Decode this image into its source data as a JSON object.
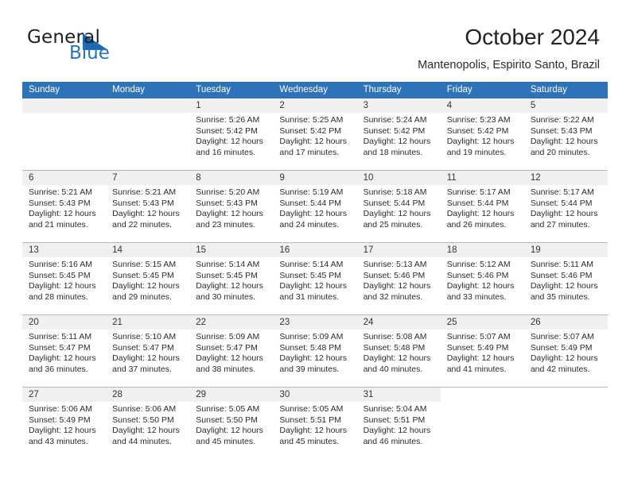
{
  "brand": {
    "name_top": "General",
    "name_bottom": "Blue",
    "accent_color": "#2a74b5",
    "triangle_color": "#1b69b0"
  },
  "header": {
    "month_title": "October 2024",
    "location": "Mantenopolis, Espirito Santo, Brazil"
  },
  "calendar": {
    "header_color": "#2e72b8",
    "date_strip_color": "#f0f0f0",
    "weekdays": [
      "Sunday",
      "Monday",
      "Tuesday",
      "Wednesday",
      "Thursday",
      "Friday",
      "Saturday"
    ],
    "labels": {
      "sunrise": "Sunrise:",
      "sunset": "Sunset:",
      "daylight": "Daylight:"
    },
    "weeks": [
      [
        {
          "type": "blank"
        },
        {
          "type": "blank"
        },
        {
          "type": "day",
          "date": "1",
          "sunrise": "Sunrise: 5:26 AM",
          "sunset": "Sunset: 5:42 PM",
          "daylight_1": "Daylight: 12 hours",
          "daylight_2": "and 16 minutes."
        },
        {
          "type": "day",
          "date": "2",
          "sunrise": "Sunrise: 5:25 AM",
          "sunset": "Sunset: 5:42 PM",
          "daylight_1": "Daylight: 12 hours",
          "daylight_2": "and 17 minutes."
        },
        {
          "type": "day",
          "date": "3",
          "sunrise": "Sunrise: 5:24 AM",
          "sunset": "Sunset: 5:42 PM",
          "daylight_1": "Daylight: 12 hours",
          "daylight_2": "and 18 minutes."
        },
        {
          "type": "day",
          "date": "4",
          "sunrise": "Sunrise: 5:23 AM",
          "sunset": "Sunset: 5:42 PM",
          "daylight_1": "Daylight: 12 hours",
          "daylight_2": "and 19 minutes."
        },
        {
          "type": "day",
          "date": "5",
          "sunrise": "Sunrise: 5:22 AM",
          "sunset": "Sunset: 5:43 PM",
          "daylight_1": "Daylight: 12 hours",
          "daylight_2": "and 20 minutes."
        }
      ],
      [
        {
          "type": "day",
          "date": "6",
          "sunrise": "Sunrise: 5:21 AM",
          "sunset": "Sunset: 5:43 PM",
          "daylight_1": "Daylight: 12 hours",
          "daylight_2": "and 21 minutes."
        },
        {
          "type": "day",
          "date": "7",
          "sunrise": "Sunrise: 5:21 AM",
          "sunset": "Sunset: 5:43 PM",
          "daylight_1": "Daylight: 12 hours",
          "daylight_2": "and 22 minutes."
        },
        {
          "type": "day",
          "date": "8",
          "sunrise": "Sunrise: 5:20 AM",
          "sunset": "Sunset: 5:43 PM",
          "daylight_1": "Daylight: 12 hours",
          "daylight_2": "and 23 minutes."
        },
        {
          "type": "day",
          "date": "9",
          "sunrise": "Sunrise: 5:19 AM",
          "sunset": "Sunset: 5:44 PM",
          "daylight_1": "Daylight: 12 hours",
          "daylight_2": "and 24 minutes."
        },
        {
          "type": "day",
          "date": "10",
          "sunrise": "Sunrise: 5:18 AM",
          "sunset": "Sunset: 5:44 PM",
          "daylight_1": "Daylight: 12 hours",
          "daylight_2": "and 25 minutes."
        },
        {
          "type": "day",
          "date": "11",
          "sunrise": "Sunrise: 5:17 AM",
          "sunset": "Sunset: 5:44 PM",
          "daylight_1": "Daylight: 12 hours",
          "daylight_2": "and 26 minutes."
        },
        {
          "type": "day",
          "date": "12",
          "sunrise": "Sunrise: 5:17 AM",
          "sunset": "Sunset: 5:44 PM",
          "daylight_1": "Daylight: 12 hours",
          "daylight_2": "and 27 minutes."
        }
      ],
      [
        {
          "type": "day",
          "date": "13",
          "sunrise": "Sunrise: 5:16 AM",
          "sunset": "Sunset: 5:45 PM",
          "daylight_1": "Daylight: 12 hours",
          "daylight_2": "and 28 minutes."
        },
        {
          "type": "day",
          "date": "14",
          "sunrise": "Sunrise: 5:15 AM",
          "sunset": "Sunset: 5:45 PM",
          "daylight_1": "Daylight: 12 hours",
          "daylight_2": "and 29 minutes."
        },
        {
          "type": "day",
          "date": "15",
          "sunrise": "Sunrise: 5:14 AM",
          "sunset": "Sunset: 5:45 PM",
          "daylight_1": "Daylight: 12 hours",
          "daylight_2": "and 30 minutes."
        },
        {
          "type": "day",
          "date": "16",
          "sunrise": "Sunrise: 5:14 AM",
          "sunset": "Sunset: 5:45 PM",
          "daylight_1": "Daylight: 12 hours",
          "daylight_2": "and 31 minutes."
        },
        {
          "type": "day",
          "date": "17",
          "sunrise": "Sunrise: 5:13 AM",
          "sunset": "Sunset: 5:46 PM",
          "daylight_1": "Daylight: 12 hours",
          "daylight_2": "and 32 minutes."
        },
        {
          "type": "day",
          "date": "18",
          "sunrise": "Sunrise: 5:12 AM",
          "sunset": "Sunset: 5:46 PM",
          "daylight_1": "Daylight: 12 hours",
          "daylight_2": "and 33 minutes."
        },
        {
          "type": "day",
          "date": "19",
          "sunrise": "Sunrise: 5:11 AM",
          "sunset": "Sunset: 5:46 PM",
          "daylight_1": "Daylight: 12 hours",
          "daylight_2": "and 35 minutes."
        }
      ],
      [
        {
          "type": "day",
          "date": "20",
          "sunrise": "Sunrise: 5:11 AM",
          "sunset": "Sunset: 5:47 PM",
          "daylight_1": "Daylight: 12 hours",
          "daylight_2": "and 36 minutes."
        },
        {
          "type": "day",
          "date": "21",
          "sunrise": "Sunrise: 5:10 AM",
          "sunset": "Sunset: 5:47 PM",
          "daylight_1": "Daylight: 12 hours",
          "daylight_2": "and 37 minutes."
        },
        {
          "type": "day",
          "date": "22",
          "sunrise": "Sunrise: 5:09 AM",
          "sunset": "Sunset: 5:47 PM",
          "daylight_1": "Daylight: 12 hours",
          "daylight_2": "and 38 minutes."
        },
        {
          "type": "day",
          "date": "23",
          "sunrise": "Sunrise: 5:09 AM",
          "sunset": "Sunset: 5:48 PM",
          "daylight_1": "Daylight: 12 hours",
          "daylight_2": "and 39 minutes."
        },
        {
          "type": "day",
          "date": "24",
          "sunrise": "Sunrise: 5:08 AM",
          "sunset": "Sunset: 5:48 PM",
          "daylight_1": "Daylight: 12 hours",
          "daylight_2": "and 40 minutes."
        },
        {
          "type": "day",
          "date": "25",
          "sunrise": "Sunrise: 5:07 AM",
          "sunset": "Sunset: 5:49 PM",
          "daylight_1": "Daylight: 12 hours",
          "daylight_2": "and 41 minutes."
        },
        {
          "type": "day",
          "date": "26",
          "sunrise": "Sunrise: 5:07 AM",
          "sunset": "Sunset: 5:49 PM",
          "daylight_1": "Daylight: 12 hours",
          "daylight_2": "and 42 minutes."
        }
      ],
      [
        {
          "type": "day",
          "date": "27",
          "sunrise": "Sunrise: 5:06 AM",
          "sunset": "Sunset: 5:49 PM",
          "daylight_1": "Daylight: 12 hours",
          "daylight_2": "and 43 minutes."
        },
        {
          "type": "day",
          "date": "28",
          "sunrise": "Sunrise: 5:06 AM",
          "sunset": "Sunset: 5:50 PM",
          "daylight_1": "Daylight: 12 hours",
          "daylight_2": "and 44 minutes."
        },
        {
          "type": "day",
          "date": "29",
          "sunrise": "Sunrise: 5:05 AM",
          "sunset": "Sunset: 5:50 PM",
          "daylight_1": "Daylight: 12 hours",
          "daylight_2": "and 45 minutes."
        },
        {
          "type": "day",
          "date": "30",
          "sunrise": "Sunrise: 5:05 AM",
          "sunset": "Sunset: 5:51 PM",
          "daylight_1": "Daylight: 12 hours",
          "daylight_2": "and 45 minutes."
        },
        {
          "type": "day",
          "date": "31",
          "sunrise": "Sunrise: 5:04 AM",
          "sunset": "Sunset: 5:51 PM",
          "daylight_1": "Daylight: 12 hours",
          "daylight_2": "and 46 minutes."
        },
        {
          "type": "void"
        },
        {
          "type": "void"
        }
      ]
    ]
  }
}
